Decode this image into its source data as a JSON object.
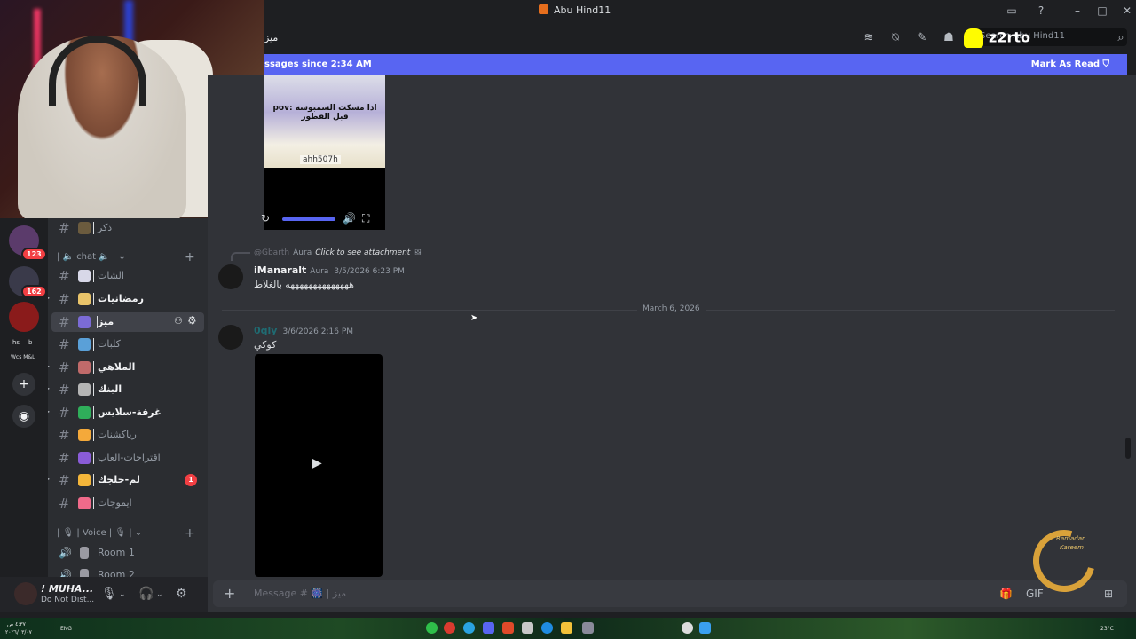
{
  "window": {
    "title": "Abu Hind11",
    "icons": [
      "inbox-icon",
      "help-icon",
      "minimize-icon",
      "maximize-icon",
      "close-icon"
    ]
  },
  "header": {
    "channel_title": "ميز",
    "search_placeholder": "Search Abu Hind11",
    "overlay_text": "z2rto"
  },
  "banner": {
    "text": "ssages since 2:34 AM",
    "mark_read": "Mark As Read"
  },
  "servers": {
    "badges": [
      "123",
      "162"
    ],
    "labels": [
      "hs",
      "b",
      "Wcs M&L"
    ]
  },
  "channels": {
    "items": [
      {
        "name": "ذكر",
        "emoji_color": "#6b5b3e",
        "unread": false
      },
      {
        "name": "الشات",
        "emoji_color": "#d8d8e8",
        "unread": false
      },
      {
        "name": "رمضانيات",
        "emoji_color": "#e9c46a",
        "unread": true
      },
      {
        "name": "ميز",
        "emoji_color": "#7b6bd6",
        "unread": true,
        "active": true
      },
      {
        "name": "كلبات",
        "emoji_color": "#5aa0d8",
        "unread": false
      },
      {
        "name": "الملاهي",
        "emoji_color": "#c06a6a",
        "unread": true
      },
      {
        "name": "البنك",
        "emoji_color": "#b5b5b5",
        "unread": true
      },
      {
        "name": "غرفة-سلايس",
        "emoji_color": "#2fae5a",
        "unread": true
      },
      {
        "name": "رياكشنات",
        "emoji_color": "#f4a93a",
        "unread": false
      },
      {
        "name": "اقتراحات-العاب",
        "emoji_color": "#8a5cd8",
        "unread": false
      },
      {
        "name": "لم-حلجك",
        "emoji_color": "#f4b63a",
        "unread": true,
        "badge": "1"
      },
      {
        "name": "ايموجات",
        "emoji_color": "#f06a8a",
        "unread": false
      }
    ],
    "category_chat": "chat",
    "category_voice": "Voice",
    "voice_rooms": [
      "Room 1",
      "Room 2"
    ]
  },
  "user": {
    "name": "! MUHA...",
    "status": "Do Not Dist..."
  },
  "messages": {
    "video_watermark": "ahh507h",
    "video_caption": "pov: اذا مسكت السمبوسه قبل الفطور",
    "reply": {
      "author": "@Gbarth",
      "tag": "Aura",
      "text": "Click to see attachment"
    },
    "msg1": {
      "author": "iManaralt",
      "tag": "Aura",
      "time": "3/5/2026 6:23 PM",
      "text": "ههههههههههههههه بالغلاط"
    },
    "divider": "March 6, 2026",
    "msg2": {
      "author": "0qly",
      "time": "3/6/2026 2:16 PM",
      "text": "كوكي"
    }
  },
  "composer": {
    "placeholder": "Message # 🎆 | ميز"
  },
  "ramadan": {
    "line1": "Ramadan",
    "line2": "Kareem"
  },
  "taskbar": {
    "lang": "ENG",
    "time_left": "٤:٣٧ ص",
    "date_left": "٢٠٢٦/٠٣/٠٧",
    "time_right": "23°C"
  },
  "colors": {
    "accent": "#5865f2",
    "danger": "#f23f43",
    "bg_chat": "#313338",
    "bg_sidebar": "#2b2d31"
  }
}
